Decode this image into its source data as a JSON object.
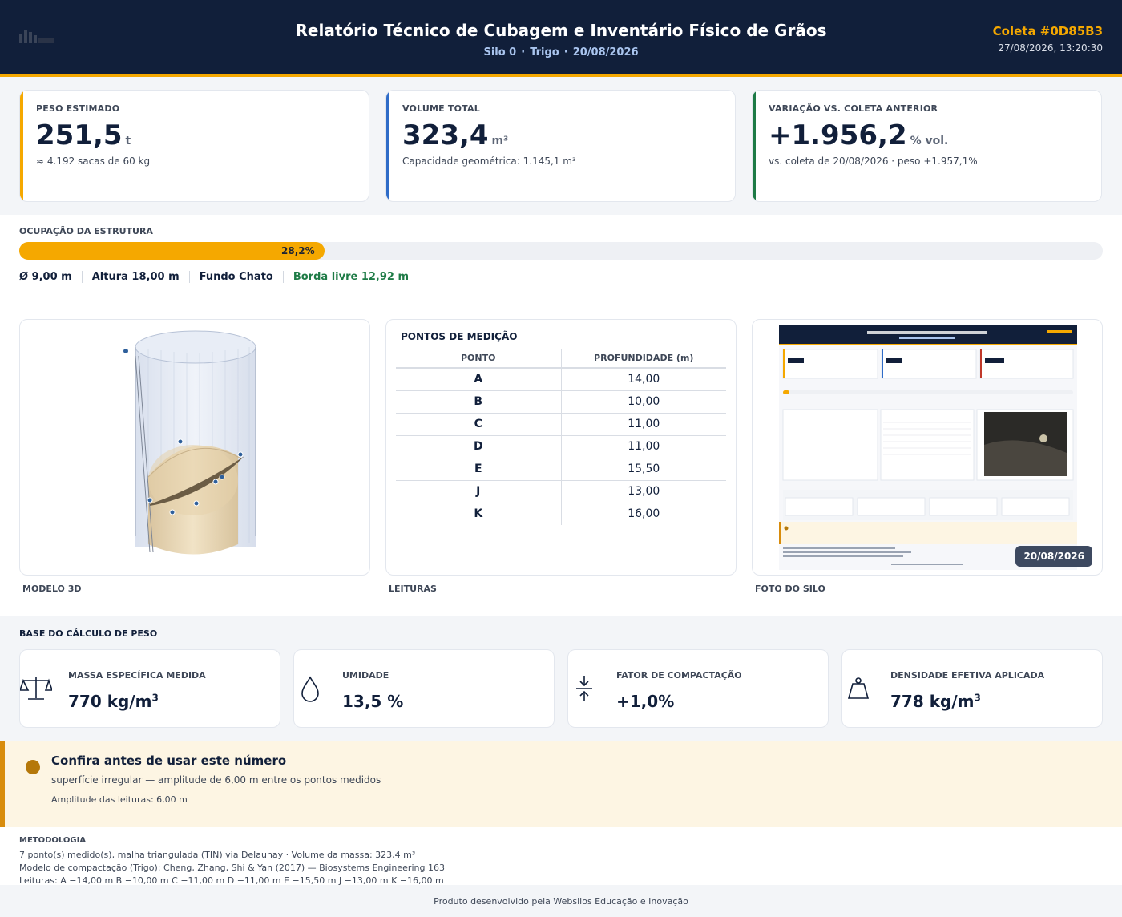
{
  "header": {
    "title": "Relatório Técnico de Cubagem e Inventário Físico de Grãos",
    "silo": "Silo 0",
    "grain": "Trigo",
    "date": "20/08/2026",
    "separator": "·",
    "code": "Coleta #0D85B3",
    "timestamp": "27/08/2026, 13:20:30"
  },
  "kpis": {
    "weight": {
      "label": "PESO ESTIMADO",
      "value": "251,5",
      "unit": "t",
      "sub": "≈ 4.192 sacas de 60 kg",
      "color": "#f5a800"
    },
    "volume": {
      "label": "VOLUME TOTAL",
      "value": "323,4",
      "unit": "m³",
      "sub": "Capacidade geométrica: 1.145,1 m³",
      "color": "#2f6cc8"
    },
    "variation": {
      "label": "VARIAÇÃO VS. COLETA ANTERIOR",
      "value": "+1.956,2",
      "unit": "% vol.",
      "sub": "vs. coleta de 20/08/2026 · peso +1.957,1%",
      "color": "#1e7b46"
    }
  },
  "occupancy": {
    "label": "OCUPAÇÃO DA ESTRUTURA",
    "fraction": 0.282,
    "percent_label": "28,2%",
    "diameter": "Ø 9,00 m",
    "height": "Altura 18,00 m",
    "bottom": "Fundo Chato",
    "freeboard": "Borda livre 12,92 m"
  },
  "panels": {
    "model_caption": "MODELO 3D",
    "readings_caption": "LEITURAS",
    "photo_caption": "FOTO DO SILO",
    "photo_date": "20/08/2026"
  },
  "points": {
    "title": "PONTOS DE MEDIÇÃO",
    "col_point": "PONTO",
    "col_depth": "PROFUNDIDADE (m)",
    "rows": [
      {
        "p": "A",
        "d": "14,00"
      },
      {
        "p": "B",
        "d": "10,00"
      },
      {
        "p": "C",
        "d": "11,00"
      },
      {
        "p": "D",
        "d": "11,00"
      },
      {
        "p": "E",
        "d": "15,50"
      },
      {
        "p": "J",
        "d": "13,00"
      },
      {
        "p": "K",
        "d": "16,00"
      }
    ]
  },
  "density": {
    "label": "BASE DO CÁLCULO DE PESO",
    "cards": [
      {
        "label": "MASSA ESPECÍFICA MEDIDA",
        "value": "770 kg/m",
        "sup": "3",
        "icon": "scale-icon"
      },
      {
        "label": "UMIDADE",
        "value": "13,5 %",
        "sup": "",
        "icon": "drop-icon"
      },
      {
        "label": "FATOR DE COMPACTAÇÃO",
        "value": "+1,0%",
        "sup": "",
        "icon": "compress-icon"
      },
      {
        "label": "DENSIDADE EFETIVA APLICADA",
        "value": "778 kg/m",
        "sup": "3",
        "icon": "weight-icon"
      }
    ]
  },
  "warning": {
    "title": "Confira antes de usar este número",
    "text": "superfície irregular — amplitude de 6,00 m entre os pontos medidos",
    "amplitude": "Amplitude das leituras: 6,00 m"
  },
  "methodology": {
    "label": "METODOLOGIA",
    "line1": "7 ponto(s) medido(s), malha triangulada (TIN) via Delaunay · Volume da massa: 323,4 m³",
    "line2": "Modelo de compactação (Trigo): Cheng, Zhang, Shi & Yan (2017) — Biosystems Engineering 163",
    "line3": "Leituras: A −14,00 m   B −10,00 m   C −11,00 m   D −11,00 m   E −15,50 m   J −13,00 m   K −16,00 m"
  },
  "footer": "Produto desenvolvido pela Websilos Educação e Inovação"
}
